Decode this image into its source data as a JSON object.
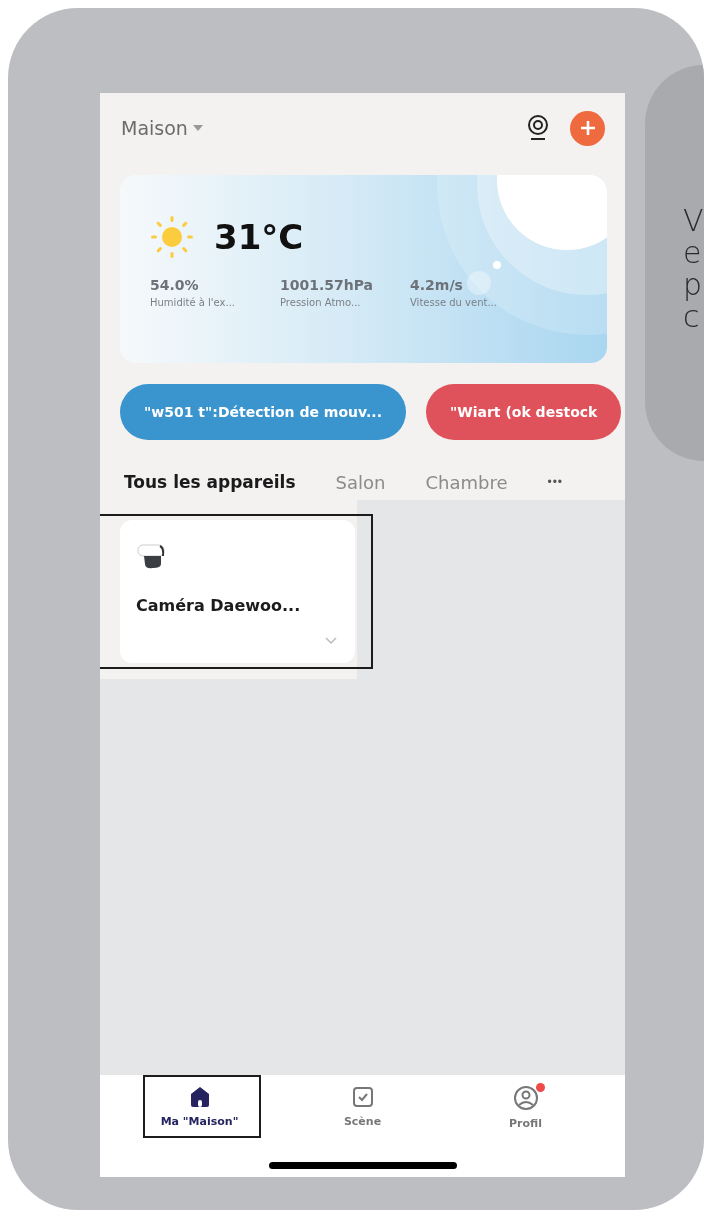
{
  "header": {
    "home_name": "Maison"
  },
  "weather": {
    "temperature": "31°C",
    "stats": [
      {
        "value": "54.0%",
        "label": "Humidité à l'ex..."
      },
      {
        "value": "1001.57hPa",
        "label": "Pression Atmo..."
      },
      {
        "value": "4.2m/s",
        "label": "Vitesse du vent..."
      }
    ]
  },
  "scenes": [
    {
      "label": "\"w501 t\":Détection de mouv...",
      "color": "#3a95cf"
    },
    {
      "label": "\"Wiart (ok destock",
      "color": "#e0525b"
    }
  ],
  "tabs": [
    {
      "label": "Tous les appareils",
      "selected": true
    },
    {
      "label": "Salon",
      "selected": false
    },
    {
      "label": "Chambre",
      "selected": false
    }
  ],
  "more": "•••",
  "devices": [
    {
      "name": "Caméra Daewoo...",
      "highlighted": true
    }
  ],
  "nav": [
    {
      "label": "Ma \"Maison\"",
      "kind": "home",
      "selected": true,
      "highlighted": true,
      "badge": false
    },
    {
      "label": "Scène",
      "kind": "scene",
      "selected": false,
      "highlighted": false,
      "badge": false
    },
    {
      "label": "Profil",
      "kind": "profile",
      "selected": false,
      "highlighted": false,
      "badge": true
    }
  ],
  "tooltip": {
    "lines": [
      "V",
      "e",
      "p",
      "c"
    ]
  }
}
